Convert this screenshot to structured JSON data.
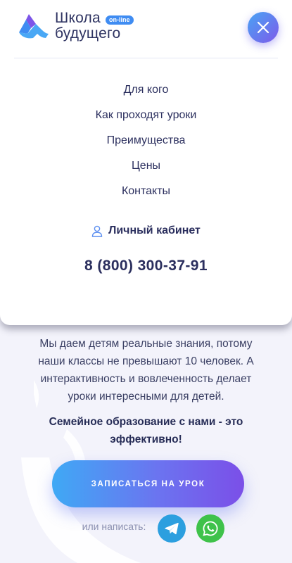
{
  "logo": {
    "line1": "Школа",
    "line2": "будущего",
    "badge": "on-line"
  },
  "menu": {
    "items": [
      {
        "label": "Для кого"
      },
      {
        "label": "Как проходят уроки"
      },
      {
        "label": "Преимущества"
      },
      {
        "label": "Цены"
      },
      {
        "label": "Контакты"
      }
    ],
    "account_label": "Личный кабинет",
    "phone": "8 (800) 300-37-91",
    "close_icon": "close-icon",
    "user_icon": "user-icon"
  },
  "hero": {
    "description": "Мы даем детям реальные знания, потому наши классы не превышают 10 человек. А интерактивность и вовлеченность делает уроки интересными для детей.",
    "strong": "Семейное образование с нами - это эффективно!",
    "cta_label": "ЗАПИСАТЬСЯ НА УРОК",
    "write_label": "или написать:",
    "social": [
      {
        "name": "telegram-icon",
        "color": "#2c9fdf"
      },
      {
        "name": "whatsapp-icon",
        "color": "#3fc24a"
      }
    ]
  },
  "colors": {
    "accent_start": "#3fa9f5",
    "accent_end": "#7b4fe8",
    "text_dark": "#2b2f5e"
  }
}
